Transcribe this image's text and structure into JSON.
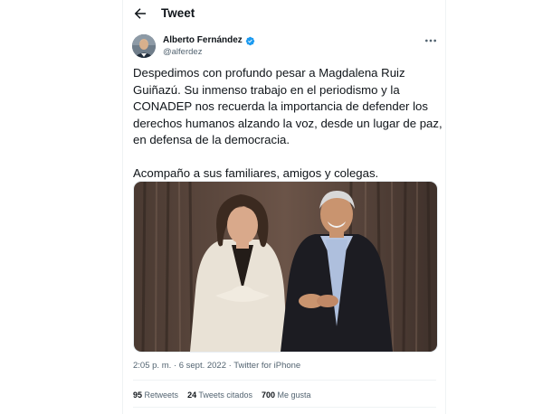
{
  "header": {
    "title": "Tweet",
    "back_icon": "arrow-left-icon"
  },
  "author": {
    "name": "Alberto Fernández",
    "handle": "@alferdez",
    "verified_icon": "verified-badge-icon",
    "verified_color": "#1d9bf0"
  },
  "tweet": {
    "paragraph1": "Despedimos con profundo pesar a Magdalena Ruiz Guiñazú. Su inmenso trabajo en el periodismo y la CONADEP nos recuerda la importancia de defender los derechos humanos alzando la voz, desde un lugar de paz, en defensa de la democracia.",
    "paragraph2": "Acompaño a sus familiares, amigos y colegas."
  },
  "meta": {
    "time": "2:05 p. m.",
    "separator": "·",
    "date": "6 sept. 2022",
    "source": "Twitter for iPhone"
  },
  "stats": {
    "retweets_count": "95",
    "retweets_label": "Retweets",
    "quotes_count": "24",
    "quotes_label": "Tweets citados",
    "likes_count": "700",
    "likes_label": "Me gusta"
  },
  "colors": {
    "text": "#0f1419",
    "secondary": "#536471",
    "accent": "#1d9bf0"
  }
}
